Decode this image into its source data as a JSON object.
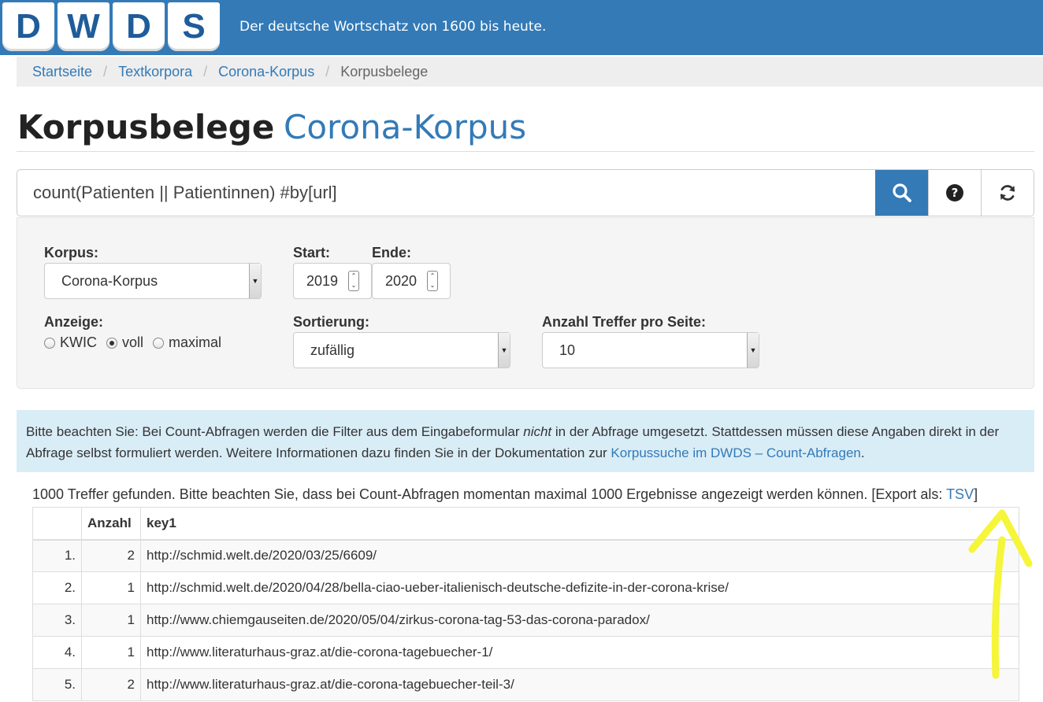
{
  "header": {
    "logo_letters": [
      "D",
      "W",
      "D",
      "S"
    ],
    "tagline": "Der deutsche Wortschatz von 1600 bis heute.",
    "background_color": "#337ab7"
  },
  "breadcrumb": {
    "items": [
      "Startseite",
      "Textkorpora",
      "Corona-Korpus"
    ],
    "current": "Korpusbelege",
    "separator": "/"
  },
  "title": {
    "main": "Korpusbelege",
    "sub": "Corona-Korpus"
  },
  "search": {
    "query": "count(Patienten || Patientinnen) #by[url]",
    "search_icon": "search-icon",
    "help_icon": "question-circle-icon",
    "reset_icon": "refresh-icon"
  },
  "filters": {
    "korpus_label": "Korpus:",
    "korpus_value": "Corona-Korpus",
    "start_label": "Start:",
    "start_value": "2019",
    "ende_label": "Ende:",
    "ende_value": "2020",
    "anzeige_label": "Anzeige:",
    "anzeige_options": [
      "KWIC",
      "voll",
      "maximal"
    ],
    "anzeige_selected": "voll",
    "sortierung_label": "Sortierung:",
    "sortierung_value": "zufällig",
    "treffer_label": "Anzahl Treffer pro Seite:",
    "treffer_value": "10"
  },
  "alert": {
    "text_before": "Bitte beachten Sie: Bei Count-Abfragen werden die Filter aus dem Eingabeformular ",
    "emphasis": "nicht",
    "text_after": " in der Abfrage umgesetzt. Stattdessen müssen diese Angaben direkt in der Abfrage selbst formuliert werden. Weitere Informationen dazu finden Sie in der Dokumentation zur ",
    "link": "Korpussuche im DWDS – Count-Abfragen",
    "end": "."
  },
  "results": {
    "summary": "1000 Treffer gefunden. Bitte beachten Sie, dass bei Count-Abfragen momentan maximal 1000 Ergebnisse angezeigt werden können. [Export als: ",
    "export_link": "TSV",
    "summary_end": "]",
    "columns": [
      "",
      "Anzahl",
      "key1"
    ],
    "rows": [
      {
        "index": "1.",
        "count": "2",
        "key": "http://schmid.welt.de/2020/03/25/6609/"
      },
      {
        "index": "2.",
        "count": "1",
        "key": "http://schmid.welt.de/2020/04/28/bella-ciao-ueber-italienisch-deutsche-defizite-in-der-corona-krise/"
      },
      {
        "index": "3.",
        "count": "1",
        "key": "http://www.chiemgauseiten.de/2020/05/04/zirkus-corona-tag-53-das-corona-paradox/"
      },
      {
        "index": "4.",
        "count": "1",
        "key": "http://www.literaturhaus-graz.at/die-corona-tagebuecher-1/"
      },
      {
        "index": "5.",
        "count": "2",
        "key": "http://www.literaturhaus-graz.at/die-corona-tagebuecher-teil-3/"
      }
    ]
  },
  "annotation": {
    "arrow_color": "#f5f53a"
  }
}
